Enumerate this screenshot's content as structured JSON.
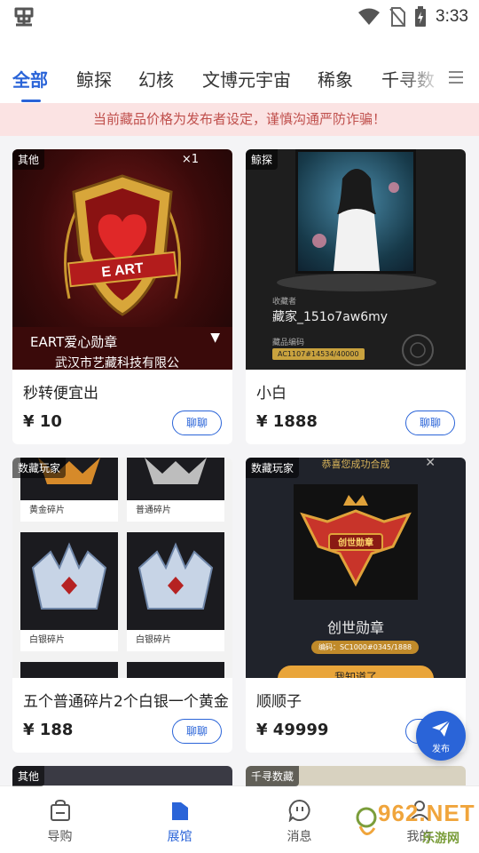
{
  "status_bar": {
    "time": "3:33",
    "app_icon": "bug-icon"
  },
  "tabs": [
    {
      "label": "全部",
      "active": true
    },
    {
      "label": "鲸探"
    },
    {
      "label": "幻核"
    },
    {
      "label": "文博元宇宙"
    },
    {
      "label": "稀象"
    },
    {
      "label": "千寻数"
    }
  ],
  "notice": "当前藏品价格为发布者设定，谨慎沟通严防诈骗！",
  "cards": [
    {
      "badge": "其他",
      "title": "秒转便宜出",
      "price": "¥ 10",
      "chat_label": "聊聊",
      "image": {
        "title": "EART爱心勋章",
        "subtitle": "武汉市艺藏科技有限公",
        "count": "×1"
      }
    },
    {
      "badge": "鲸探",
      "title": "小白",
      "price": "¥ 1888",
      "chat_label": "聊聊",
      "image": {
        "label_owner": "收藏者",
        "owner": "藏家_151o7aw6my",
        "label_code": "藏品编码",
        "code": "AC1107#14534/40000"
      }
    },
    {
      "badge": "数藏玩家",
      "title": "五个普通碎片2个白银一个黄金",
      "price": "¥ 188",
      "chat_label": "聊聊",
      "image": {
        "captions": [
          "黄金碎片",
          "普通碎片",
          "白银碎片",
          "白银碎片"
        ]
      }
    },
    {
      "badge": "数藏玩家",
      "title": "顺顺子",
      "price": "¥ 49999",
      "chat_label": "聊聊",
      "image": {
        "header": "恭喜您成功合成",
        "name": "创世勋章",
        "code": "编码：SC1000#0345/1888",
        "button": "我知道了"
      }
    }
  ],
  "partial_cards": [
    {
      "badge": "其他"
    },
    {
      "badge": "千寻数藏"
    }
  ],
  "fab": {
    "label": "发布",
    "icon": "send-icon"
  },
  "bottom_nav": [
    {
      "label": "导购",
      "icon": "bag-icon"
    },
    {
      "label": "展馆",
      "icon": "gallery-icon",
      "active": true
    },
    {
      "label": "消息",
      "icon": "message-icon"
    },
    {
      "label": "我的",
      "icon": "user-icon"
    }
  ],
  "watermark": {
    "text": "962.NET",
    "sub": "乐游网"
  },
  "colors": {
    "accent": "#2a64d8",
    "notice_bg": "#fbe3e3",
    "notice_text": "#c0504d"
  }
}
